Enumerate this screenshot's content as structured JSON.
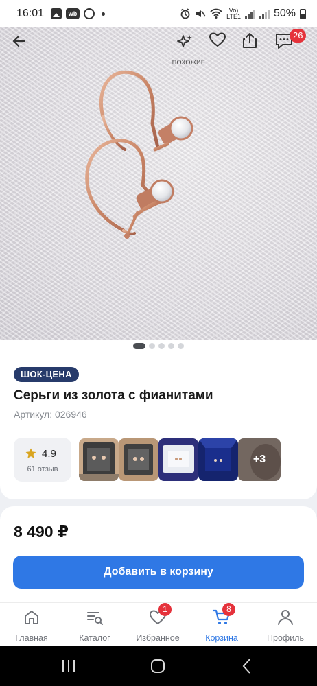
{
  "status_bar": {
    "time": "16:01",
    "app_badge": "wb",
    "network_label_top": "Vo)",
    "network_label_bottom": "LTE1",
    "battery": "50%"
  },
  "hero": {
    "similar_label": "ПОХОЖИЕ",
    "chat_badge": "26",
    "slides_total": 5,
    "slide_active": 1
  },
  "product": {
    "promo_tag": "ШОК-ЦЕНА",
    "title": "Серьги из золота с фианитами",
    "article": "Артикул: 026946",
    "rating": "4.9",
    "reviews": "61 отзыв",
    "more_photos": "+3"
  },
  "purchase": {
    "price": "8 490 ₽",
    "add_to_cart": "Добавить в корзину"
  },
  "nav": {
    "items": [
      {
        "label": "Главная",
        "icon": "home-icon"
      },
      {
        "label": "Каталог",
        "icon": "catalog-icon"
      },
      {
        "label": "Избранное",
        "icon": "heart-icon",
        "badge": "1"
      },
      {
        "label": "Корзина",
        "icon": "cart-icon",
        "badge": "8"
      },
      {
        "label": "Профиль",
        "icon": "profile-icon"
      }
    ],
    "active_color": "#2f78e5"
  },
  "colors": {
    "accent": "#2f78e5",
    "badge": "#e5323b",
    "promo": "#273b6b",
    "star": "#d9a520"
  }
}
